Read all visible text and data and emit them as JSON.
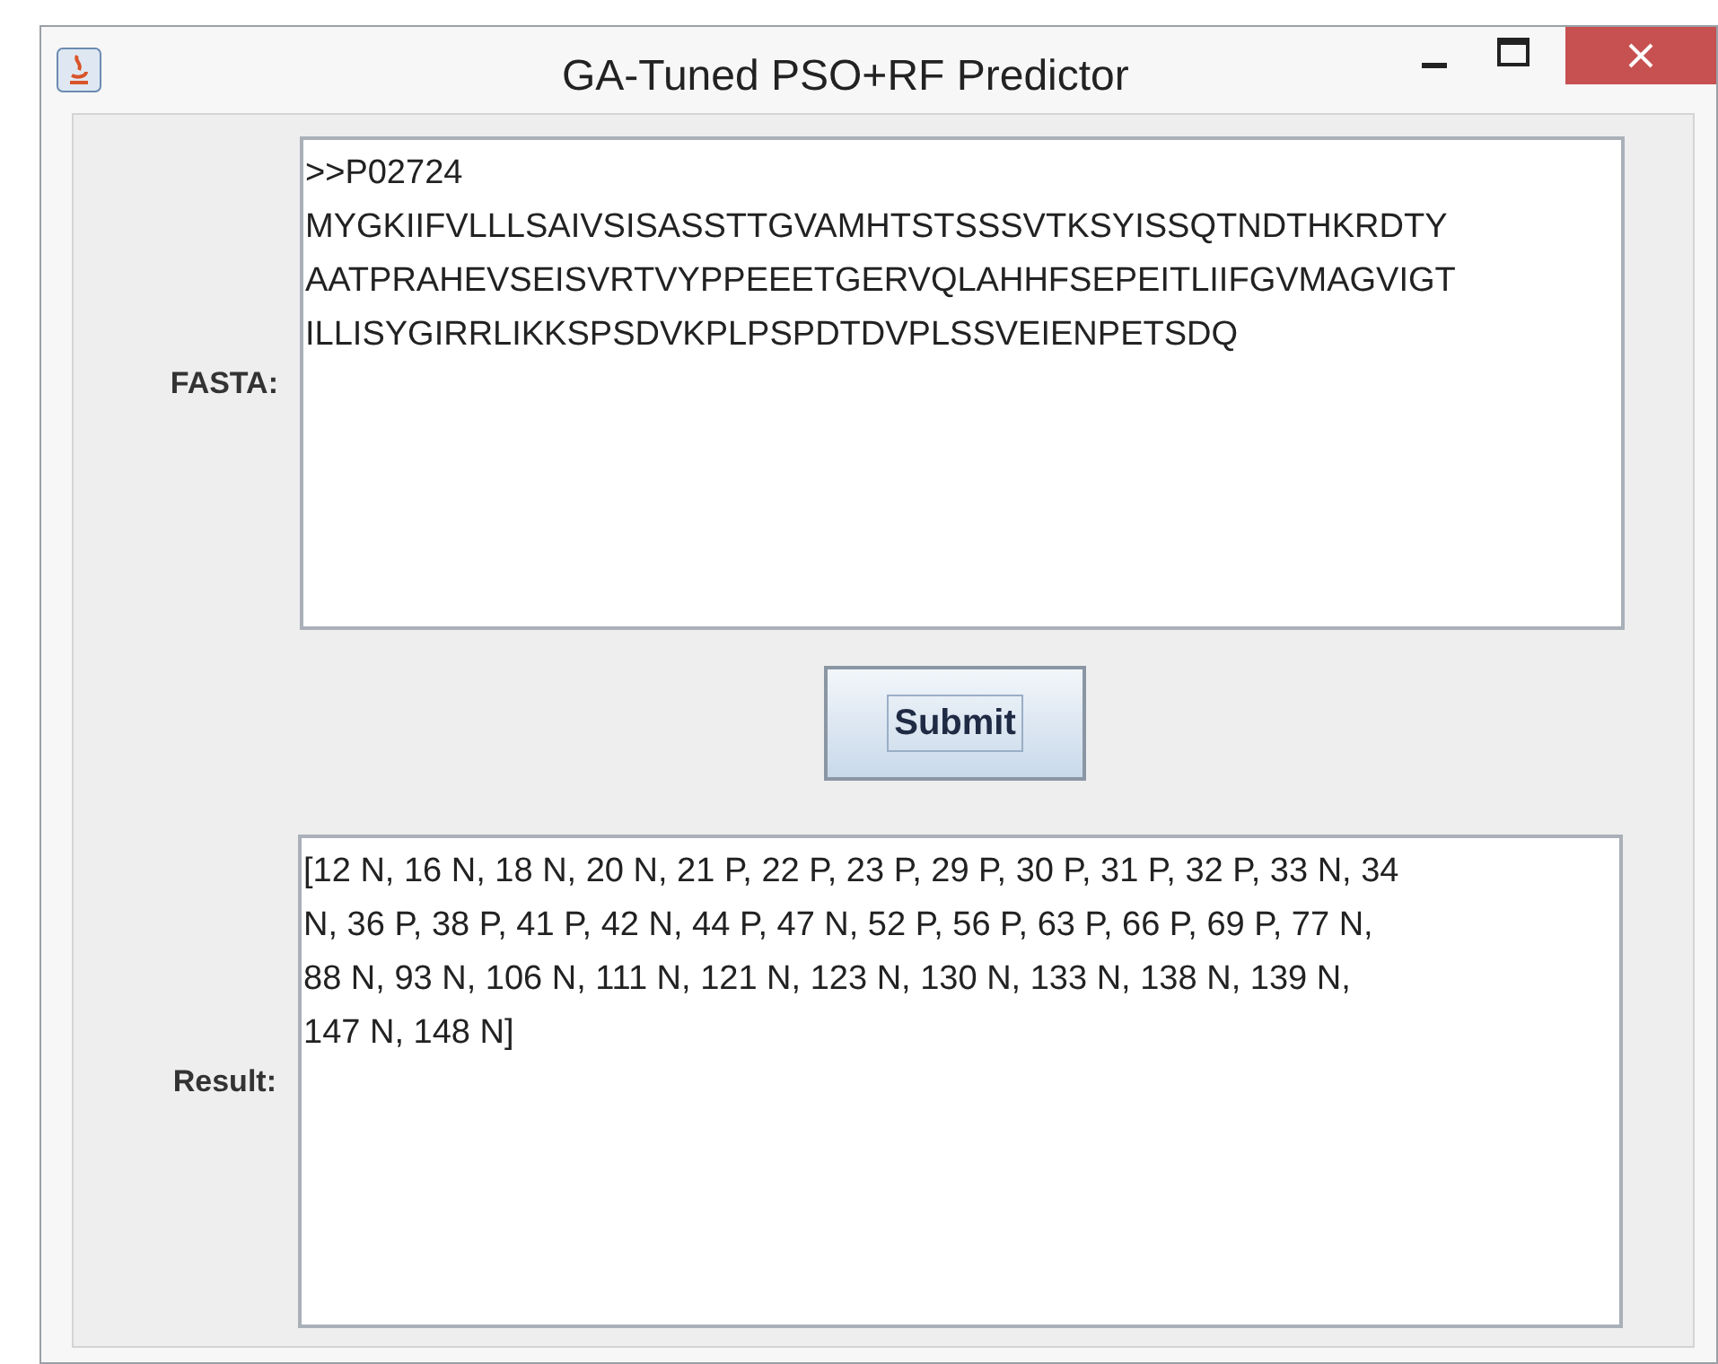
{
  "window": {
    "title": "GA-Tuned PSO+RF Predictor"
  },
  "fasta": {
    "label": "FASTA:",
    "lines": [
      ">>P02724",
      "MYGKIIFVLLLSAIVSISASSTTGVAMHTSTSSSVTKSYISSQTNDTHKRDTY",
      "AATPRAHEVSEISVRTVYPPEEETGERVQLAHHFSEPEITLIIFGVMAGVIGT",
      "ILLISYGIRRLIKKSPSDVKPLPSPDTDVPLSSVEIENPETSDQ"
    ]
  },
  "submit": {
    "label": "Submit"
  },
  "result": {
    "label": "Result:",
    "lines": [
      "[12 N, 16 N, 18 N, 20 N, 21 P, 22 P, 23 P, 29 P, 30 P, 31 P, 32 P, 33 N, 34",
      "N, 36 P, 38 P, 41 P, 42 N, 44 P, 47 N, 52 P, 56 P, 63 P, 66 P, 69 P, 77 N,",
      "88 N, 93 N, 106 N, 111 N, 121 N, 123 N, 130 N, 133 N, 138 N, 139 N,",
      "147 N, 148 N]"
    ]
  }
}
